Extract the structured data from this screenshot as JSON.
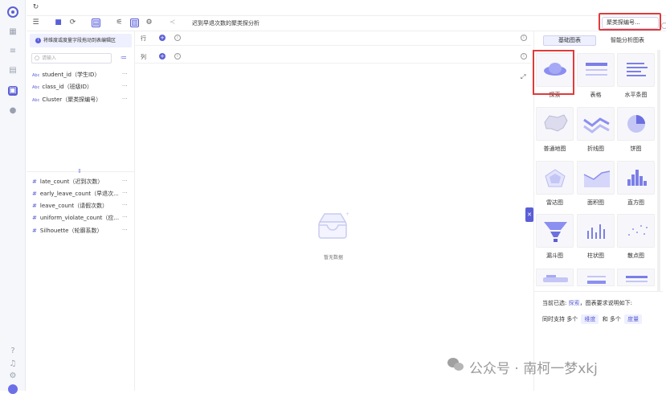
{
  "toolbar": {
    "chart_title": "迟到早退次数的聚类探分析",
    "cluster_button": "聚类探编号..."
  },
  "fields_panel": {
    "hint": "将维度或度量字段拖动到表编辑区",
    "search_placeholder": "请输入",
    "dimensions": [
      {
        "type": "Abc",
        "label": "student_id（学生ID）"
      },
      {
        "type": "Abc",
        "label": "class_id（班级ID）"
      },
      {
        "type": "Abc",
        "label": "Cluster（聚类探编号）"
      }
    ],
    "measures": [
      {
        "type": "#",
        "label": "late_count（迟到次数）"
      },
      {
        "type": "#",
        "label": "early_leave_count（早退次..."
      },
      {
        "type": "#",
        "label": "leave_count（请假次数）"
      },
      {
        "type": "#",
        "label": "uniform_violate_count（应..."
      },
      {
        "type": "#",
        "label": "Silhouette（轮廓系数）"
      }
    ],
    "more": "···"
  },
  "canvas": {
    "row_label": "行",
    "col_label": "列",
    "empty_text": "暂无数据"
  },
  "chart_panel": {
    "tabs": [
      "基础图表",
      "智能分析图表"
    ],
    "charts": [
      "探索",
      "表格",
      "水平条图",
      "普通地图",
      "折线图",
      "饼图",
      "雷达图",
      "面积图",
      "直方图",
      "漏斗图",
      "柱状图",
      "散点图"
    ],
    "desc_prefix": "当前已选:",
    "desc_selected": "探索",
    "desc_suffix": "，图表要求说明如下:",
    "desc2_a": "同时支持 多个",
    "desc2_chip1": "维度",
    "desc2_b": "和 多个",
    "desc2_chip2": "度量"
  },
  "watermark": "公众号 · 南柯一梦xkj",
  "colors": {
    "accent": "#5b5fd6",
    "highlight": "#e03b3b"
  }
}
